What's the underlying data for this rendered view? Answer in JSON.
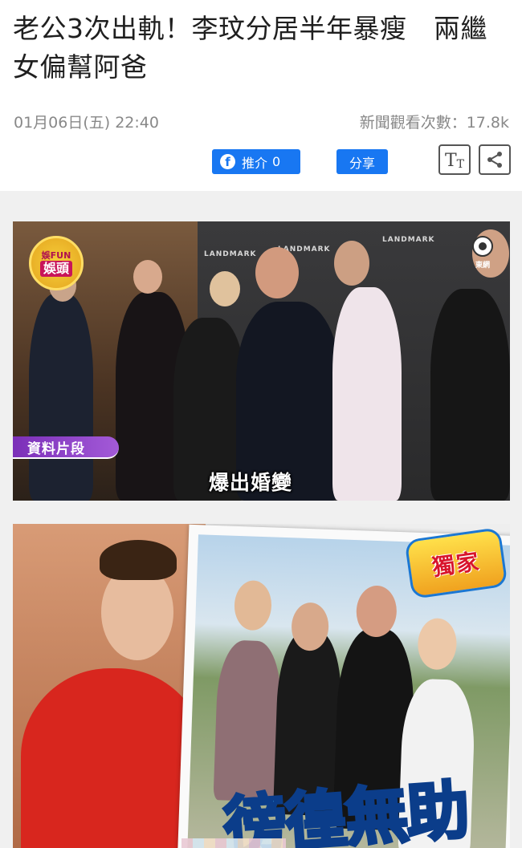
{
  "article": {
    "title": "老公3次出軌！李玟分居半年暴瘦　兩繼女偏幫阿爸",
    "date": "01月06日(五) 22:40",
    "views": "新聞觀看次數：17.8k"
  },
  "actions": {
    "like_label": "推介",
    "like_count": "0",
    "facebook_glyph": "f",
    "share_label": "分享",
    "font_size_big": "T",
    "font_size_small": "T",
    "share_icon": "share-icon"
  },
  "images": [
    {
      "logo_top": "娛FUN",
      "logo_bottom": "娛頭",
      "tvb_label": "東網",
      "landmark_texts": [
        "LANDMARK",
        "LANDMARK",
        "LANDMARK"
      ],
      "tag": "資料片段",
      "caption": "爆出婚變"
    },
    {
      "exclusive_badge": "獨家",
      "banner": "徬徨無助"
    }
  ],
  "colors": {
    "facebook_blue": "#1877f2",
    "tag_purple": "#7b2fb8",
    "banner_blue": "#3fb8e8"
  }
}
